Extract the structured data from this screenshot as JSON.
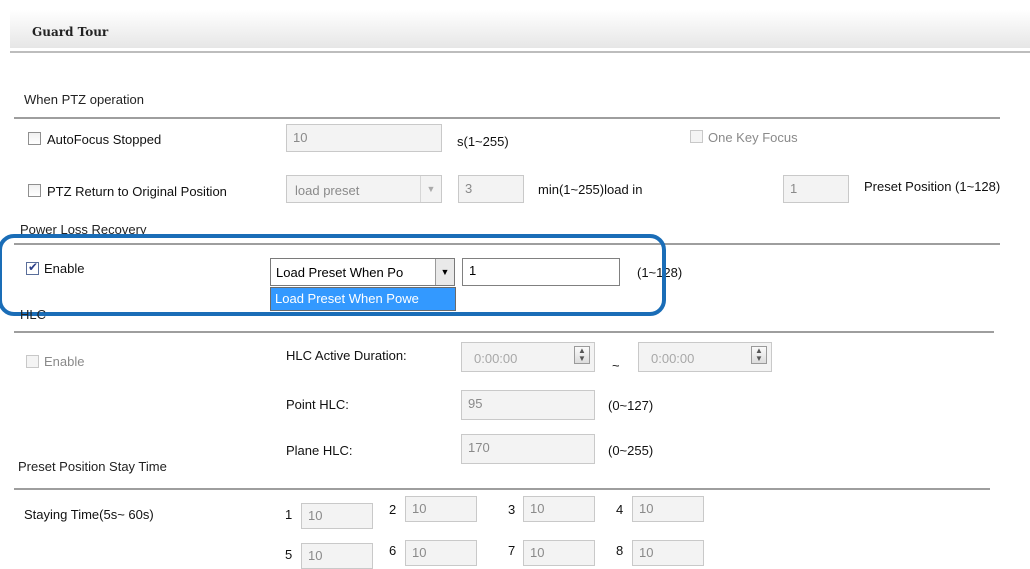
{
  "header": {
    "title": "Guard Tour"
  },
  "ptz": {
    "section_title": "When PTZ operation",
    "autofocus_label": "AutoFocus Stopped",
    "autofocus_value": "10",
    "autofocus_range": "s(1~255)",
    "one_key_focus_label": "One Key Focus",
    "return_label": "PTZ Return to Original Position",
    "return_mode": "load preset",
    "return_minutes": "3",
    "return_range": "min(1~255)load in",
    "return_preset": "1",
    "return_preset_label": "Preset Position (1~128)"
  },
  "power": {
    "section_title": "Power Loss Recovery",
    "enable_label": "Enable",
    "enable_checked": true,
    "mode": "Load Preset When Po",
    "dropdown_option": "Load Preset When Powe",
    "preset_value": "1",
    "preset_range": "(1~128)"
  },
  "hlc": {
    "section_title": "HLC",
    "enable_label": "Enable",
    "active_duration_label": "HLC Active Duration:",
    "start_time": "0:00:00",
    "tilde": "~",
    "end_time": "0:00:00",
    "point_label": "Point HLC:",
    "point_value": "95",
    "point_range": "(0~127)",
    "plane_label": "Plane HLC:",
    "plane_value": "170",
    "plane_range": "(0~255)"
  },
  "stay": {
    "section_title": "Preset Position Stay Time",
    "staying_label": "Staying Time(5s~ 60s)",
    "presets": [
      {
        "num": "1",
        "value": "10"
      },
      {
        "num": "2",
        "value": "10"
      },
      {
        "num": "3",
        "value": "10"
      },
      {
        "num": "4",
        "value": "10"
      },
      {
        "num": "5",
        "value": "10"
      },
      {
        "num": "6",
        "value": "10"
      },
      {
        "num": "7",
        "value": "10"
      },
      {
        "num": "8",
        "value": "10"
      }
    ]
  },
  "colors": {
    "highlight": "#1a6db7",
    "selection": "#3399ff"
  },
  "icons": [
    "checkbox-icon",
    "dropdown-arrow-icon",
    "spinner-icon"
  ]
}
